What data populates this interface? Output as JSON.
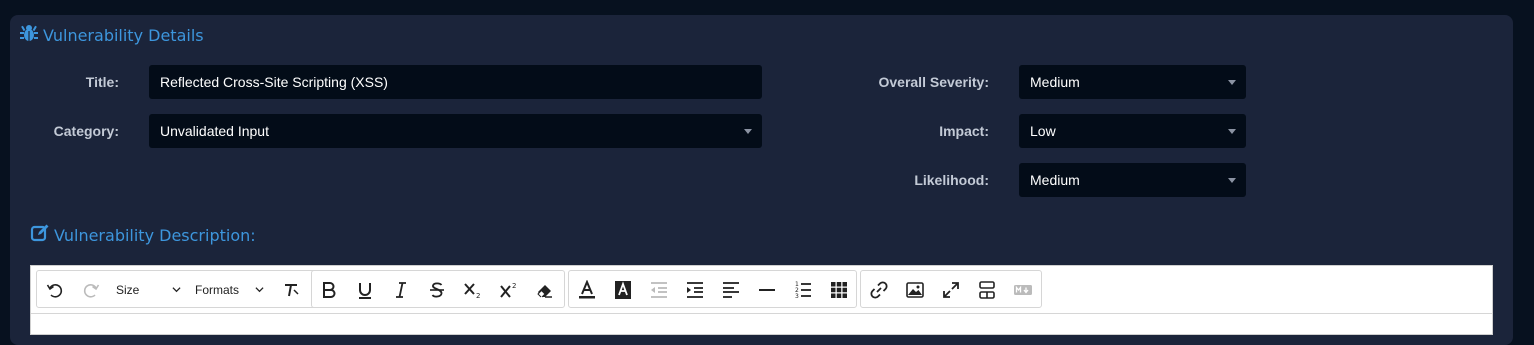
{
  "section": {
    "title": "Vulnerability Details",
    "icon": "bug-icon"
  },
  "fields": {
    "title": {
      "label": "Title:",
      "value": "Reflected Cross-Site Scripting (XSS)"
    },
    "category": {
      "label": "Category:",
      "value": "Unvalidated Input"
    },
    "overall_severity": {
      "label": "Overall Severity:",
      "value": "Medium"
    },
    "impact": {
      "label": "Impact:",
      "value": "Low"
    },
    "likelihood": {
      "label": "Likelihood:",
      "value": "Medium"
    }
  },
  "description": {
    "title": "Vulnerability Description:",
    "icon": "edit-square-icon"
  },
  "toolbar": {
    "size_label": "Size",
    "formats_label": "Formats",
    "icons": [
      "undo-icon",
      "redo-icon",
      "clear-format-icon",
      "bold-icon",
      "underline-icon",
      "italic-icon",
      "strikethrough-icon",
      "subscript-icon",
      "superscript-icon",
      "eraser-icon",
      "text-color-icon",
      "background-color-icon",
      "outdent-icon",
      "indent-icon",
      "align-left-icon",
      "horizontal-rule-icon",
      "ordered-list-icon",
      "table-icon",
      "link-icon",
      "image-icon",
      "fullscreen-icon",
      "template-icon",
      "markdown-icon"
    ]
  },
  "colors": {
    "accent": "#3d96dd",
    "panel": "#1b243a",
    "field": "#030c18",
    "page": "#07111f"
  }
}
